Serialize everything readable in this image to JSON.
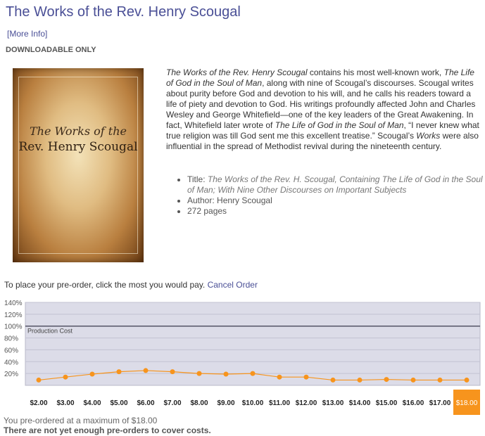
{
  "page": {
    "title": "The Works of the Rev. Henry Scougal",
    "more_info": "[More Info]",
    "availability": "DOWNLOADABLE ONLY"
  },
  "cover": {
    "line1": "The Works of the",
    "line2": "Rev. Henry Scougal"
  },
  "description": {
    "s1_title": "The Works of the Rev. Henry Scougal",
    "s1_text": " contains his most well-known work, ",
    "s2_title": "The Life of God in the Soul of Man",
    "s2_text": ", along with nine of Scougal’s discourses. Scougal writes about purity before God and devotion to his will, and he calls his readers toward a life of piety and devotion to God. His writings profoundly affected John and Charles Wesley and George Whitefield—one of the key leaders of the Great Awakening. In fact, Whitefield later wrote of ",
    "s3_title": "The Life of God in the Soul of Man",
    "s3_text": ", “I never knew what true religion was till God sent me this excellent treatise.” Scougal’s ",
    "s4_title": "Works",
    "s4_text": " were also influential in the spread of Methodist revival during the nineteenth century."
  },
  "details": {
    "title_label": "Title: ",
    "title_value": "The Works of the Rev. H. Scougal, Containing The Life of God in the Soul of Man; With Nine Other Discourses on Important Subjects",
    "author": "Author: Henry Scougal",
    "pages": "272 pages"
  },
  "preorder": {
    "prompt": "To place your pre-order, click the most you would pay.",
    "cancel": "Cancel Order"
  },
  "status": {
    "max_line": "You pre-ordered at a maximum of $18.00",
    "note": "There are not yet enough pre-orders to cover costs."
  },
  "colors": {
    "line": "#f7941d",
    "selected_bg": "#f7941d",
    "plot_bg": "#dcdce8",
    "cost_line": "#555566"
  },
  "chart_data": {
    "type": "line",
    "categories": [
      "$2.00",
      "$3.00",
      "$4.00",
      "$5.00",
      "$6.00",
      "$7.00",
      "$8.00",
      "$9.00",
      "$10.00",
      "$11.00",
      "$12.00",
      "$13.00",
      "$14.00",
      "$15.00",
      "$16.00",
      "$17.00",
      "$18.00"
    ],
    "values": [
      9,
      14,
      19,
      23,
      25,
      23,
      20,
      19,
      20,
      14,
      14,
      9,
      9,
      10,
      9,
      9,
      9
    ],
    "yticks": [
      20,
      40,
      60,
      80,
      100,
      120,
      140
    ],
    "ytick_labels": [
      "20%",
      "40%",
      "60%",
      "80%",
      "100%",
      "120%",
      "140%"
    ],
    "ylim": [
      0,
      140
    ],
    "reference_line": {
      "value": 100,
      "label": "Production Cost"
    },
    "selected": "$18.00",
    "grid": true
  }
}
